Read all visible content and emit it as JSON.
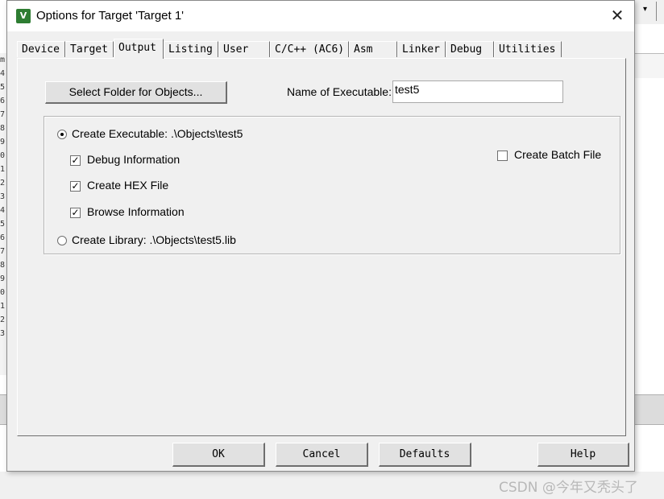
{
  "background": {
    "line_numbers": [
      "m",
      "4",
      "5",
      "6",
      "7",
      "8",
      "9",
      "0",
      "1",
      "2",
      "3",
      "4",
      "5",
      "6",
      "7",
      "8",
      "9",
      "0",
      "1",
      "2",
      "3"
    ],
    "toolbar_chevron": "▾"
  },
  "dialog": {
    "title": "Options for Target 'Target 1'",
    "icon_glyph": "V",
    "close_glyph": "✕"
  },
  "tabs": [
    {
      "label": "Device"
    },
    {
      "label": "Target"
    },
    {
      "label": "Output",
      "active": true
    },
    {
      "label": "Listing"
    },
    {
      "label": "User"
    },
    {
      "label": "C/C++ (AC6)"
    },
    {
      "label": "Asm"
    },
    {
      "label": "Linker"
    },
    {
      "label": "Debug"
    },
    {
      "label": "Utilities"
    }
  ],
  "output": {
    "select_folder_label": "Select Folder for Objects...",
    "name_label": "Name of Executable:",
    "name_value": "test5",
    "create_executable": {
      "label": "Create Executable:  .\\Objects\\test5",
      "checked": true
    },
    "debug_info": {
      "label": "Debug Information",
      "checked": true
    },
    "create_hex": {
      "label": "Create HEX File",
      "checked": true
    },
    "browse_info": {
      "label": "Browse Information",
      "checked": true
    },
    "create_library": {
      "label": "Create Library:  .\\Objects\\test5.lib",
      "checked": false
    },
    "create_batch": {
      "label": "Create Batch File",
      "checked": false
    }
  },
  "buttons": {
    "ok": "OK",
    "cancel": "Cancel",
    "defaults": "Defaults",
    "help": "Help"
  },
  "check_glyph": "✓",
  "watermark": "CSDN @今年又秃头了"
}
